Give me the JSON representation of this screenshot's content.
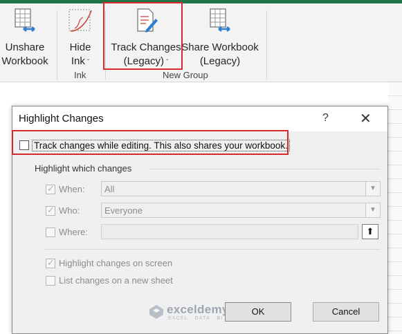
{
  "ribbon": {
    "unshare": {
      "line1": "Unshare",
      "line2": "Workbook"
    },
    "hide_ink": {
      "line1": "Hide",
      "line2": "Ink",
      "chevron": "ˇ"
    },
    "ink_group": "Ink",
    "track_changes": {
      "line1": "Track Changes",
      "line2": "(Legacy)",
      "chevron": "ˇ"
    },
    "share_workbook": {
      "line1": "Share Workbook",
      "line2": "(Legacy)"
    },
    "new_group": "New Group"
  },
  "dialog": {
    "title": "Highlight Changes",
    "help": "?",
    "close": "✕",
    "track_label": "Track changes while editing. This also shares your workbook.",
    "group_title": "Highlight which changes",
    "when_label": "When:",
    "when_value": "All",
    "who_label": "Who:",
    "who_value": "Everyone",
    "where_label": "Where:",
    "highlight_screen": "Highlight changes on screen",
    "list_sheet": "List changes on a new sheet",
    "ok": "OK",
    "cancel": "Cancel"
  },
  "watermark": {
    "name": "exceldemy",
    "tagline": "EXCEL · DATA · BI"
  },
  "colors": {
    "accent": "#217346",
    "highlight_box": "#d9272e"
  }
}
